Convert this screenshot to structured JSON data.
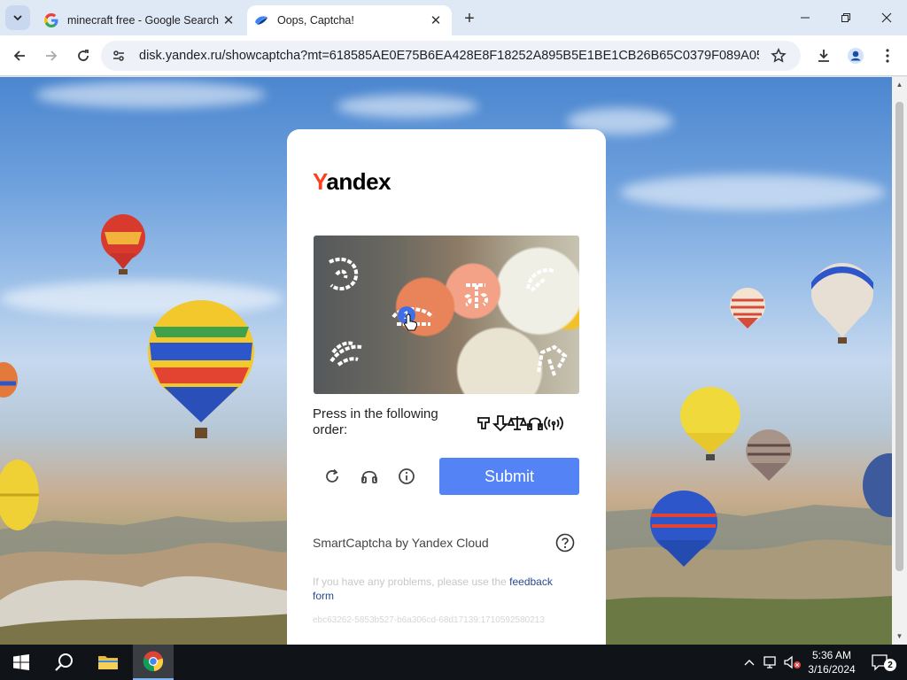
{
  "browser": {
    "tabs": [
      {
        "title": "minecraft free - Google Search",
        "favicon": "google-icon",
        "active": false
      },
      {
        "title": "Oops, Captcha!",
        "favicon": "yandex-disk-icon",
        "active": true
      }
    ],
    "url": "disk.yandex.ru/showcaptcha?mt=618585AE0E75B6EA428E8F18252A895B5E1BE1CB26B65C0379F089A0559AC9C..."
  },
  "captcha": {
    "logo": {
      "first": "Y",
      "rest": "andex"
    },
    "cursor_badge": "1",
    "instruction": "Press in the following order:",
    "order_icons": [
      "hand-point-icon",
      "arrow-down-icon",
      "scales-icon",
      "headphones-icon",
      "broadcast-icon"
    ],
    "submit_label": "Submit",
    "brand_text": "SmartCaptcha by Yandex Cloud",
    "problem_text": "If you have any problems, please use the ",
    "problem_link": "feedback form",
    "token": "ebc63262-5853b527-b6a306cd-68d17139:1710592580213"
  },
  "taskbar": {
    "time": "5:36 AM",
    "date": "3/16/2024",
    "notification_count": "2"
  },
  "colors": {
    "accent": "#5383f5",
    "yandex_red": "#fc3f1d",
    "link": "#264a8e"
  }
}
